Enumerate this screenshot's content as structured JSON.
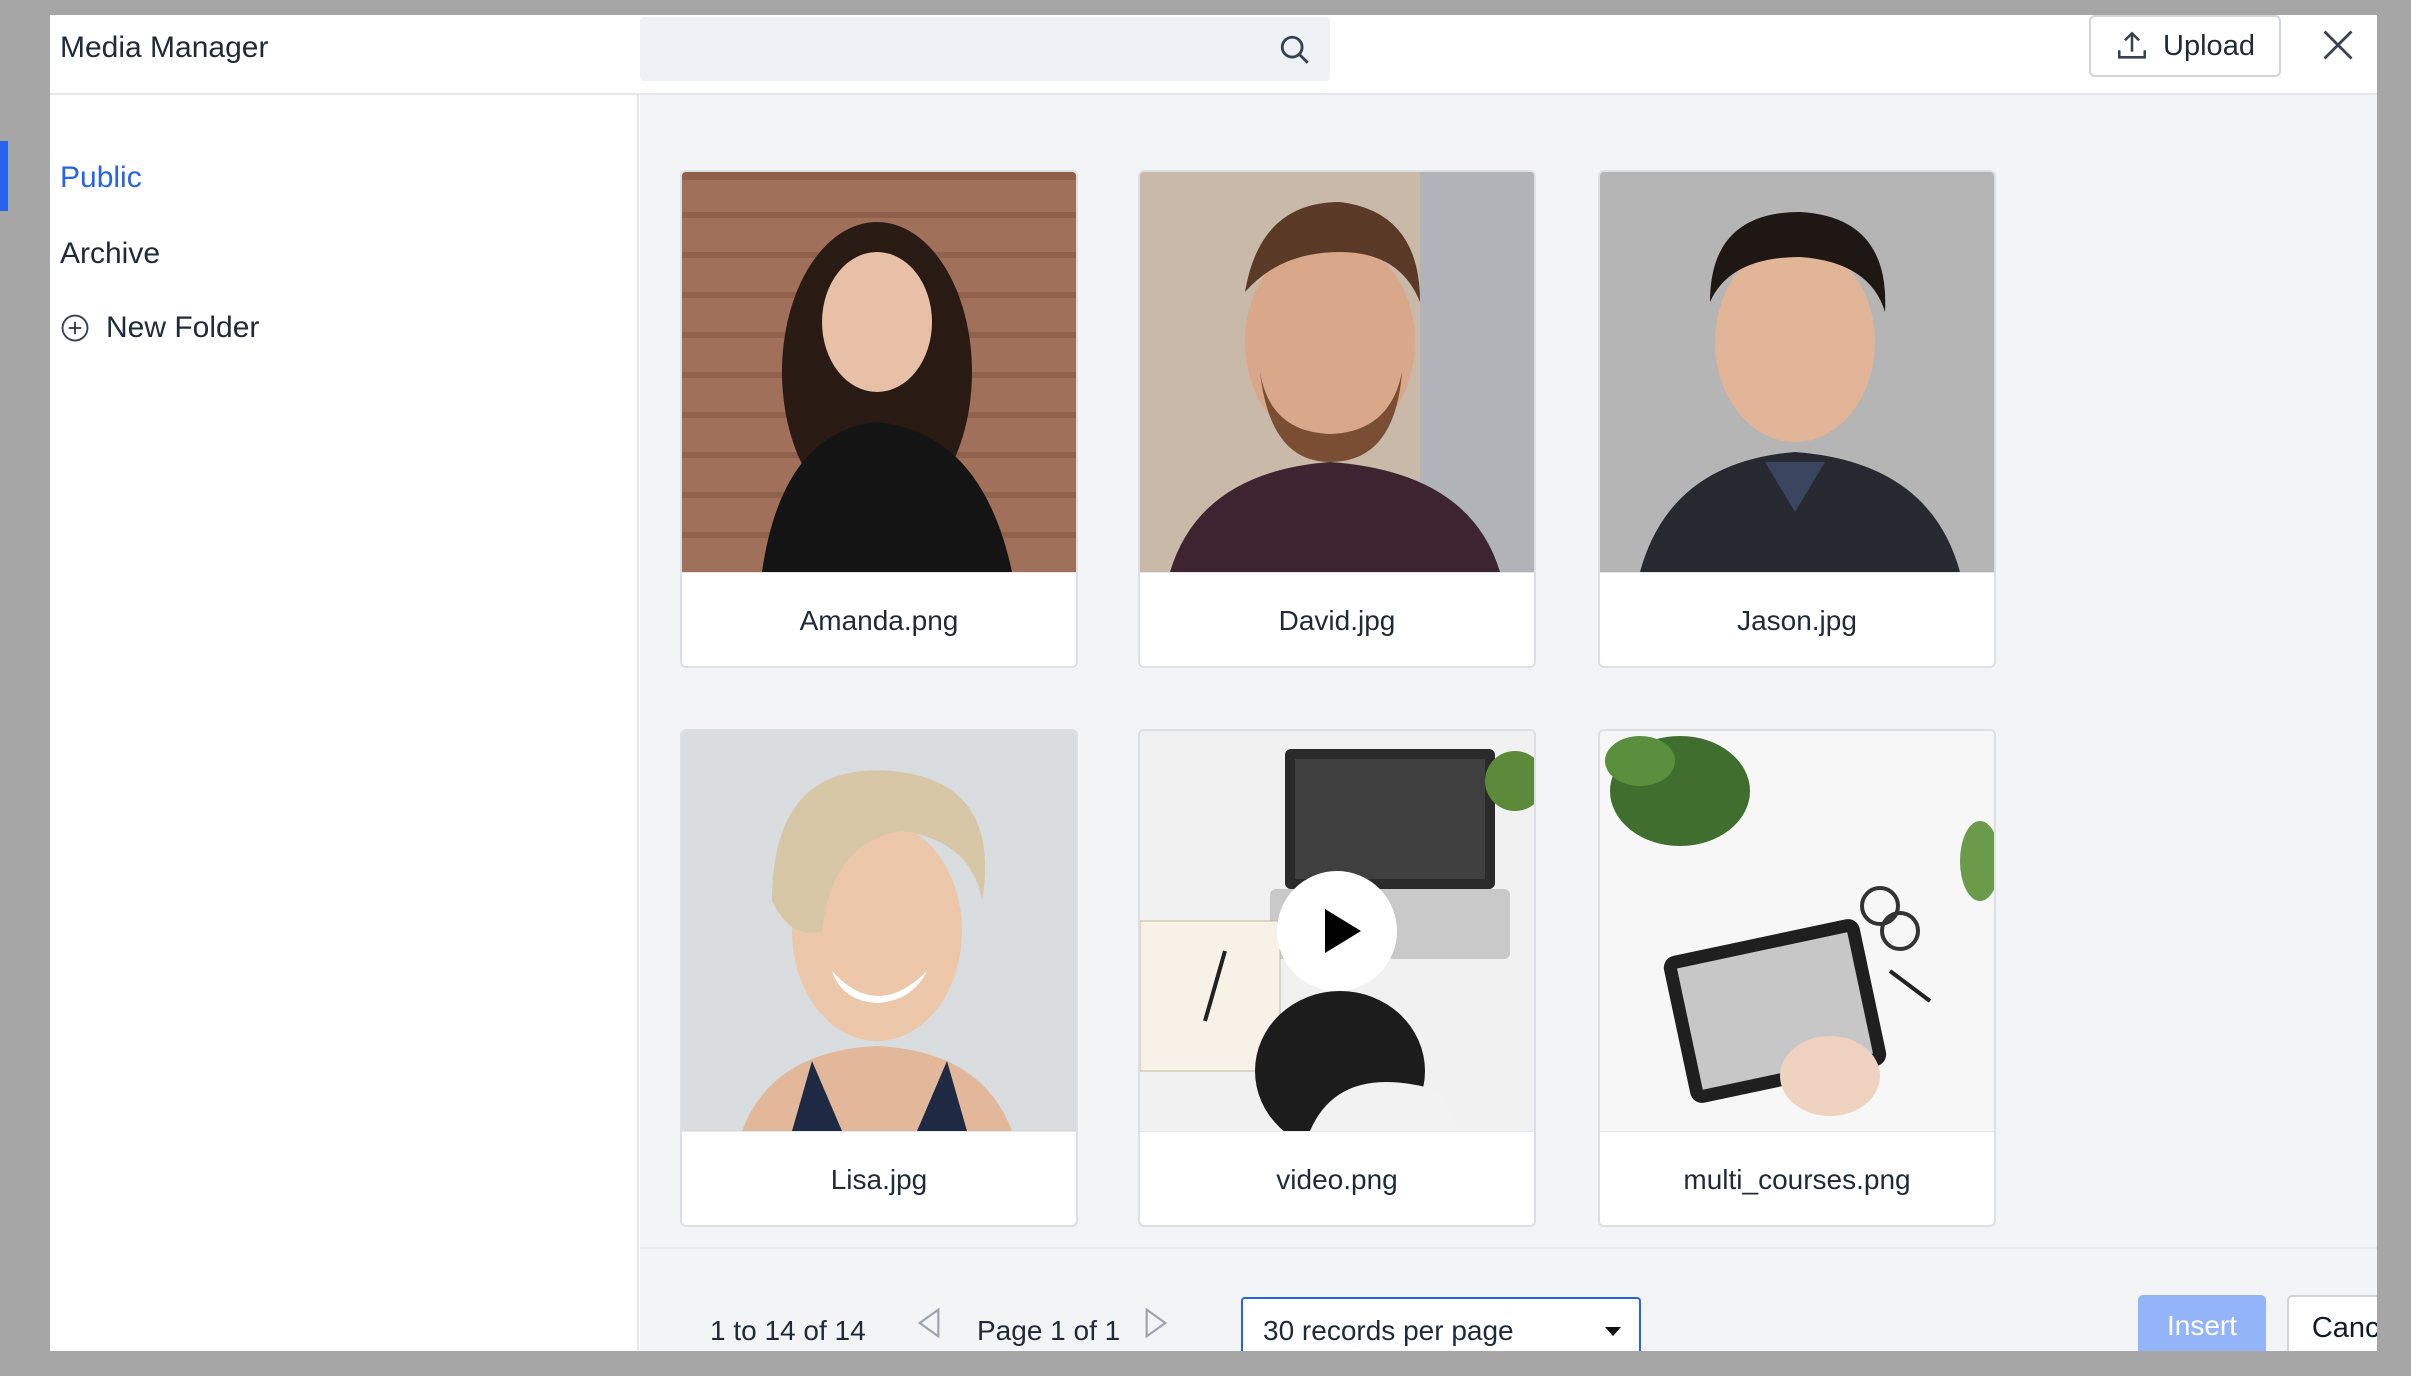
{
  "header": {
    "title": "Media Manager",
    "search_placeholder": "",
    "upload_label": "Upload"
  },
  "sidebar": {
    "items": [
      {
        "label": "Public",
        "active": true
      },
      {
        "label": "Archive",
        "active": false
      }
    ],
    "new_folder_label": "New Folder"
  },
  "media": [
    {
      "name": "Amanda.png",
      "type": "image"
    },
    {
      "name": "David.jpg",
      "type": "image"
    },
    {
      "name": "Jason.jpg",
      "type": "image"
    },
    {
      "name": "Lisa.jpg",
      "type": "image"
    },
    {
      "name": "video.png",
      "type": "video"
    },
    {
      "name": "multi_courses.png",
      "type": "image"
    }
  ],
  "footer": {
    "range_text": "1 to 14 of 14",
    "page_text": "Page 1 of 1",
    "records_per_page": "30 records per page",
    "insert_label": "Insert",
    "cancel_label": "Cancel"
  },
  "colors": {
    "accent": "#2563eb",
    "insert_disabled": "#93b4f8"
  }
}
